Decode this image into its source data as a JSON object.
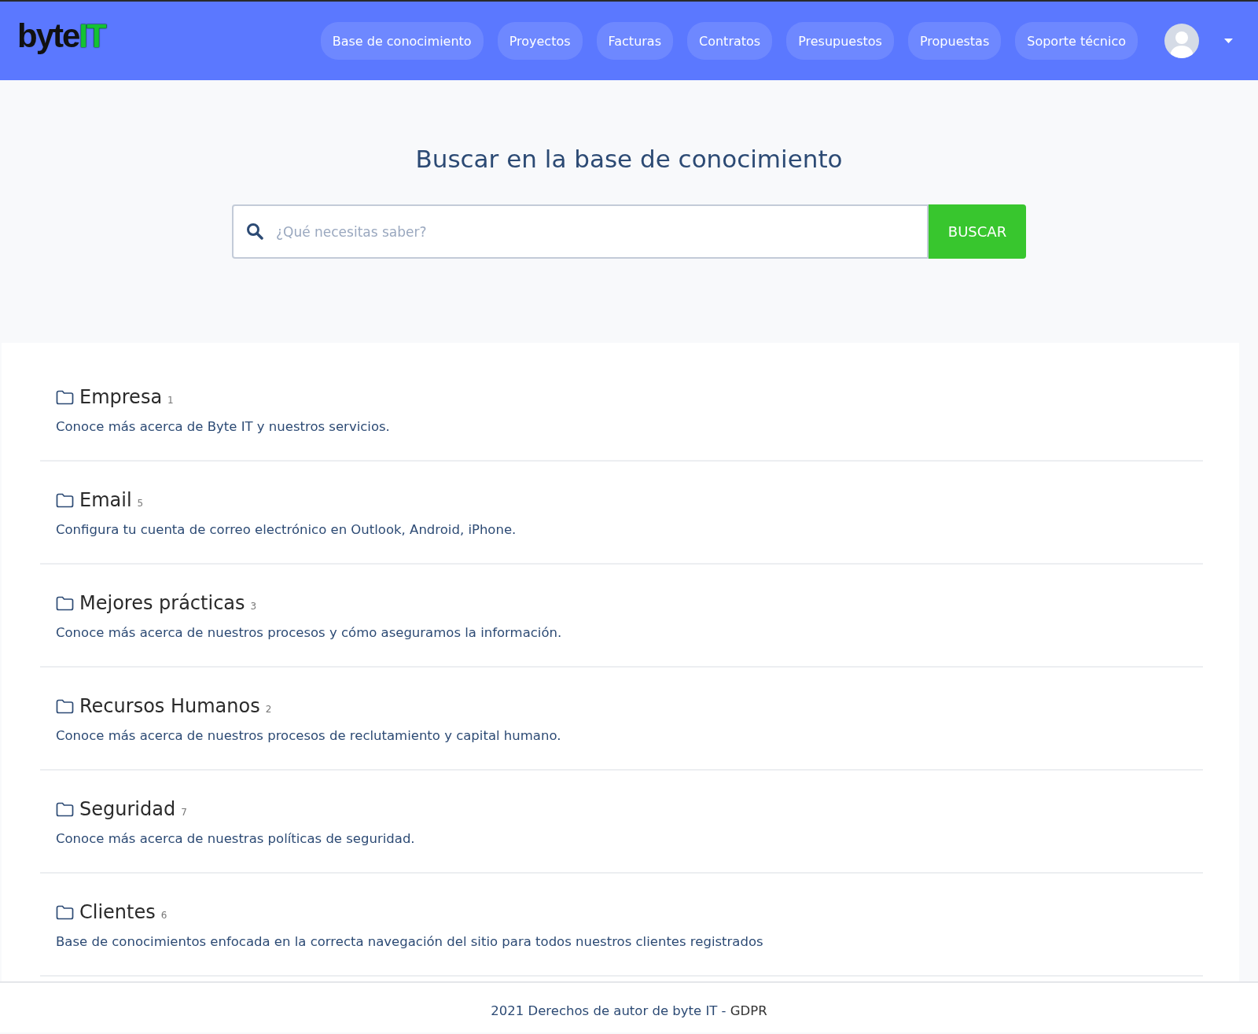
{
  "logo": {
    "main": "byte",
    "accent": "IT"
  },
  "nav": [
    {
      "label": "Base de conocimiento"
    },
    {
      "label": "Proyectos"
    },
    {
      "label": "Facturas"
    },
    {
      "label": "Contratos"
    },
    {
      "label": "Presupuestos"
    },
    {
      "label": "Propuestas"
    },
    {
      "label": "Soporte técnico"
    }
  ],
  "hero": {
    "title": "Buscar en la base de conocimiento",
    "search": {
      "placeholder": "¿Qué necesitas saber?"
    },
    "button": "BUSCAR"
  },
  "categories": [
    {
      "title": "Empresa",
      "count": "1",
      "description": "Conoce más acerca de Byte IT y nuestros servicios."
    },
    {
      "title": "Email",
      "count": "5",
      "description": "Configura tu cuenta de correo electrónico en Outlook, Android, iPhone."
    },
    {
      "title": "Mejores prácticas",
      "count": "3",
      "description": "Conoce más acerca de nuestros procesos y cómo aseguramos la información."
    },
    {
      "title": "Recursos Humanos",
      "count": "2",
      "description": "Conoce más acerca de nuestros procesos de reclutamiento y capital humano."
    },
    {
      "title": "Seguridad",
      "count": "7",
      "description": "Conoce más acerca de nuestras políticas de seguridad."
    },
    {
      "title": "Clientes",
      "count": "6",
      "description": "Base de conocimientos enfocada en la correcta navegación del sitio para todos nuestros clientes registrados"
    }
  ],
  "footer": {
    "text": "2021 Derechos de autor de byte IT - ",
    "link": "GDPR"
  }
}
